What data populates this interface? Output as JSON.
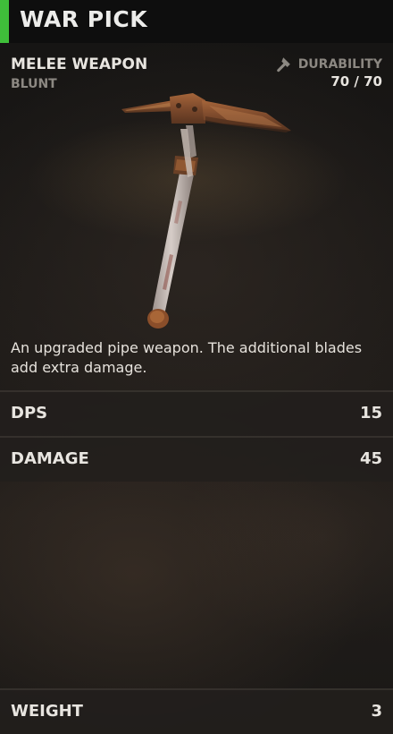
{
  "item": {
    "name": "WAR PICK",
    "category": "MELEE WEAPON",
    "subcategory": "BLUNT",
    "durability_label": "DURABILITY",
    "durability_value": "70 / 70",
    "description": "An upgraded pipe weapon. The additional blades add extra damage."
  },
  "stats": [
    {
      "label": "DPS",
      "value": "15"
    },
    {
      "label": "DAMAGE",
      "value": "45"
    },
    {
      "label": "WEIGHT",
      "value": "3"
    }
  ],
  "icons": {
    "durability": "hammer-icon"
  },
  "colors": {
    "rarity_accent": "#3fbf3a"
  }
}
